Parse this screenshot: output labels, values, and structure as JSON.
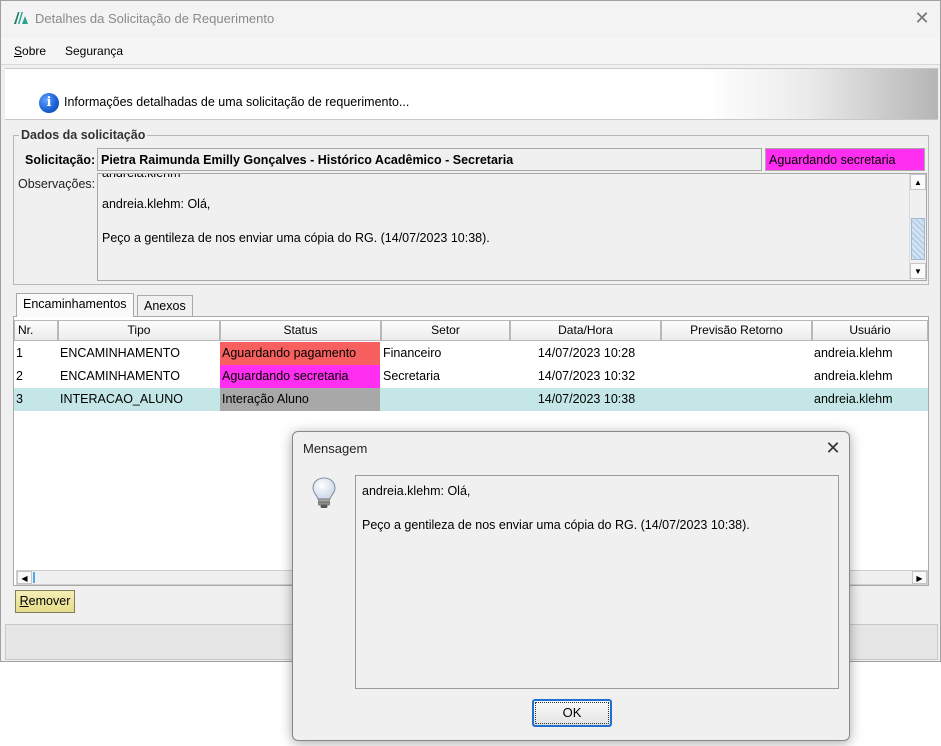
{
  "window": {
    "title": "Detalhes da Solicitação de Requerimento",
    "close_glyph": "✕"
  },
  "menu": {
    "items": [
      {
        "accel": "S",
        "rest": "obre"
      },
      {
        "label": "Segurança"
      }
    ]
  },
  "banner": {
    "text": "Informações detalhadas de uma solicitação de requerimento..."
  },
  "dados": {
    "legend": "Dados da solicitação",
    "solicitacao_label": "Solicitação:",
    "solicitacao_value": "Pietra Raimunda Emilly Gonçalves - Histórico Acadêmico - Secretaria",
    "status_value": "Aguardando secretaria",
    "status_color": "#ff2ef0",
    "observacoes_label": "Observações:",
    "observacoes_lines": [
      "andreia.klehm: Olá,",
      "Peço a gentileza de nos enviar uma cópia do RG. (14/07/2023 10:38)."
    ]
  },
  "tabs": [
    {
      "label": "Encaminhamentos"
    },
    {
      "label": "Anexos"
    }
  ],
  "table": {
    "columns": [
      "Nr.",
      "Tipo",
      "Status",
      "Setor",
      "Data/Hora",
      "Previsão Retorno",
      "Usuário"
    ],
    "rows": [
      {
        "nr": "1",
        "tipo": "ENCAMINHAMENTO",
        "status": "Aguardando pagamento",
        "status_color": "#f86060",
        "setor": "Financeiro",
        "datahora": "14/07/2023 10:28",
        "previsao": "",
        "usuario": "andreia.klehm"
      },
      {
        "nr": "2",
        "tipo": "ENCAMINHAMENTO",
        "status": "Aguardando secretaria",
        "status_color": "#ff2ef0",
        "setor": "Secretaria",
        "datahora": "14/07/2023 10:32",
        "previsao": "",
        "usuario": "andreia.klehm"
      },
      {
        "nr": "3",
        "tipo": "INTERACAO_ALUNO",
        "status": "Interação Aluno",
        "status_color": "#a8a8a8",
        "setor": "",
        "datahora": "14/07/2023 10:38",
        "previsao": "",
        "usuario": "andreia.klehm"
      }
    ],
    "selected_row_color": "#c4e6e6"
  },
  "remover_button": {
    "accel": "R",
    "rest": "emover"
  },
  "dialog": {
    "title": "Mensagem",
    "close_glyph": "✕",
    "icon": "lightbulb-icon",
    "lines": [
      "andreia.klehm: Olá,",
      "Peço a gentileza de nos enviar uma cópia do RG. (14/07/2023 10:38)."
    ],
    "ok_label": "OK"
  }
}
